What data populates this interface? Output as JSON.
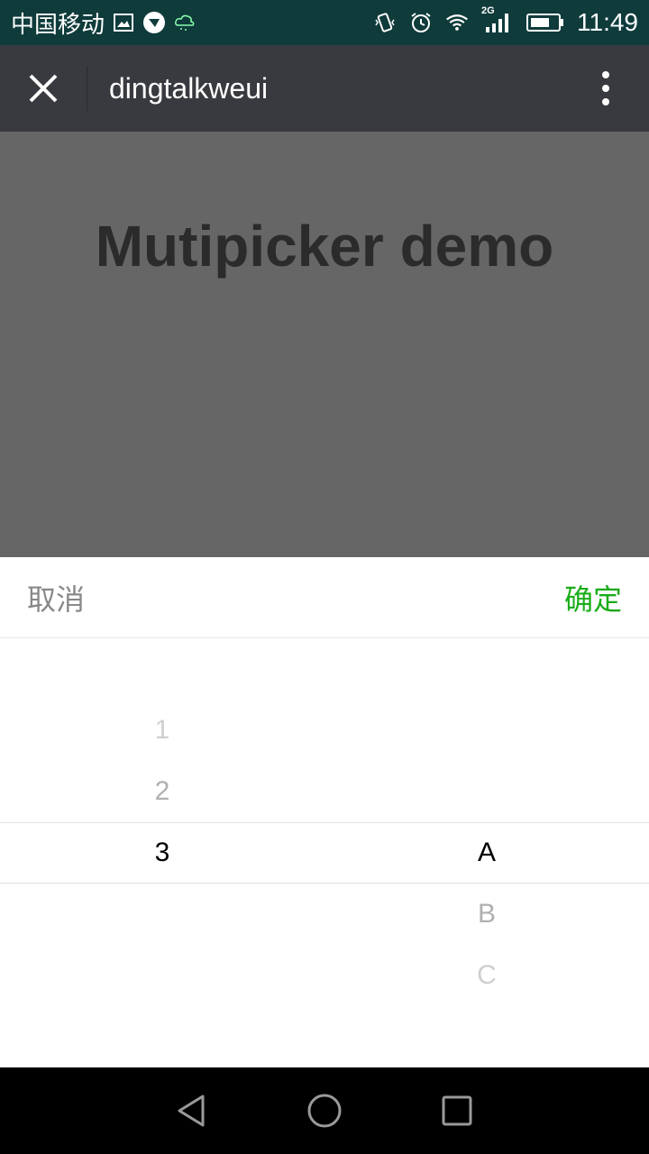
{
  "status_bar": {
    "carrier": "中国移动",
    "network": "2G",
    "time": "11:49",
    "icons": [
      "image-icon",
      "shield-app-icon",
      "cloud-icon",
      "vibrate-icon",
      "alarm-icon",
      "wifi-icon",
      "signal-icon",
      "battery-icon"
    ]
  },
  "navbar": {
    "title": "dingtalkweui",
    "close_icon": "close-icon",
    "more_icon": "more-vertical-icon"
  },
  "page": {
    "title": "Mutipicker demo"
  },
  "picker": {
    "cancel_label": "取消",
    "confirm_label": "确定",
    "confirm_color": "#1aad19",
    "columns": [
      {
        "items": [
          "1",
          "2",
          "3"
        ],
        "selected": "3"
      },
      {
        "items": [
          "A",
          "B",
          "C"
        ],
        "selected": "A"
      }
    ]
  },
  "system_nav": {
    "icons": [
      "back-icon",
      "home-icon",
      "recents-icon"
    ]
  }
}
